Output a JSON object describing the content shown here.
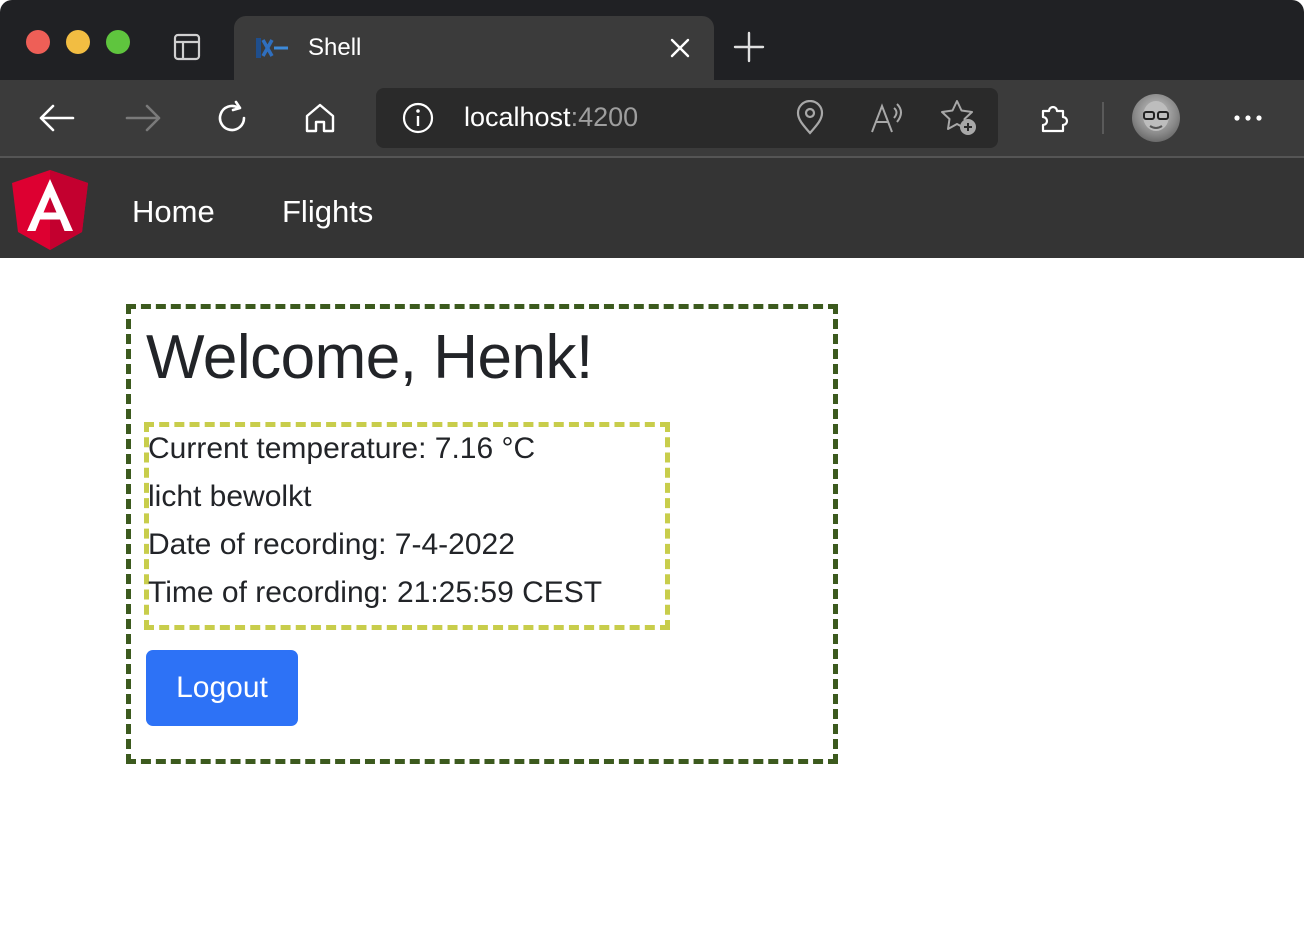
{
  "browser": {
    "tab_title": "Shell",
    "url_host": "localhost",
    "url_port": ":4200"
  },
  "navbar": {
    "logo_letter": "A",
    "links": [
      {
        "label": "Home"
      },
      {
        "label": "Flights"
      }
    ]
  },
  "content": {
    "welcome": "Welcome, Henk!",
    "temperature": "Current temperature: 7.16 °C",
    "description": "licht bewolkt",
    "date": "Date of recording: 7-4-2022",
    "time": "Time of recording: 21:25:59 CEST",
    "logout_label": "Logout"
  },
  "colors": {
    "outer_border": "#3c5a1e",
    "inner_border": "#c8cd4b",
    "logout_button": "#2d72f6",
    "navbar": "#343434",
    "angular_red": "#dd0031"
  },
  "icons": [
    "tab-actions-icon",
    "favicon-icon",
    "close-icon",
    "new-tab-icon",
    "back-icon",
    "forward-icon",
    "refresh-icon",
    "home-icon",
    "info-icon",
    "location-icon",
    "read-aloud-icon",
    "favorites-add-icon",
    "extensions-icon",
    "more-icon",
    "angular-logo-icon"
  ]
}
